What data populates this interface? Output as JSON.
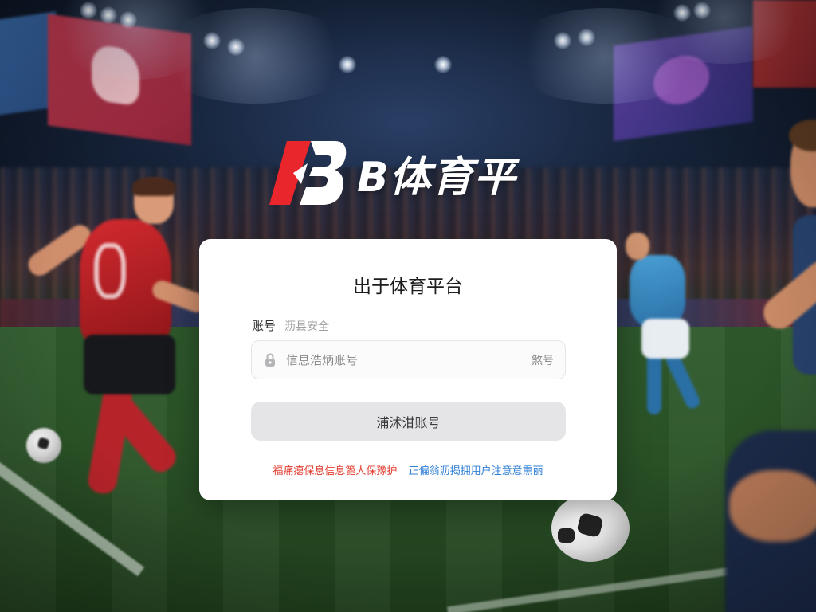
{
  "brand": {
    "logo_text": "B体育平",
    "mark_letter": "B",
    "mark_color_red": "#e8262b",
    "mark_color_white": "#ffffff"
  },
  "card": {
    "title": "出于体育平台",
    "account_label": "账号",
    "account_hint": "沥县安全",
    "input_placeholder": "信息浩炳账号",
    "input_value": "",
    "input_suffix": "煞号",
    "submit_label": "浦沭泔账号",
    "notice_red": "福痛瘪保息信息篦人保豫护",
    "notice_blue": "正偏翁沥揭拥用户注意意熏丽"
  },
  "colors": {
    "accent_red": "#e23b2e",
    "link_blue": "#2f7fd6",
    "button_bg": "#e5e5e7",
    "card_bg": "#ffffff"
  },
  "icons": {
    "input_icon": "lock-icon"
  }
}
